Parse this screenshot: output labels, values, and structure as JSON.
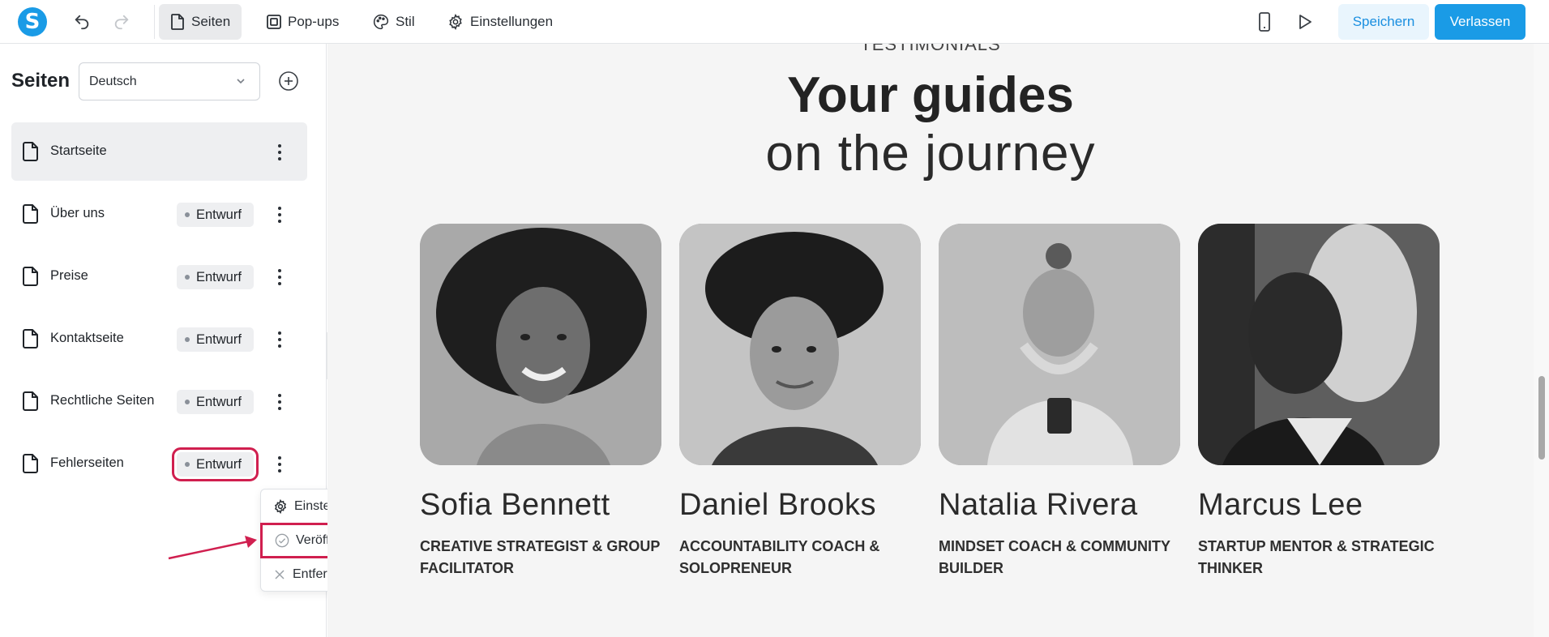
{
  "topbar": {
    "logo_letter": "S",
    "tabs": [
      {
        "label": "Seiten",
        "icon": "page-icon"
      },
      {
        "label": "Pop-ups",
        "icon": "popup-icon"
      },
      {
        "label": "Stil",
        "icon": "palette-icon"
      },
      {
        "label": "Einstellungen",
        "icon": "gear-icon"
      }
    ],
    "save_label": "Speichern",
    "exit_label": "Verlassen",
    "accent": "#1a9be6"
  },
  "sidebar": {
    "title": "Seiten",
    "language": "Deutsch",
    "pages": [
      {
        "name": "Startseite",
        "status": ""
      },
      {
        "name": "Über uns",
        "status": "Entwurf"
      },
      {
        "name": "Preise",
        "status": "Entwurf"
      },
      {
        "name": "Kontaktseite",
        "status": "Entwurf"
      },
      {
        "name": "Rechtliche Seiten",
        "status": "Entwurf"
      },
      {
        "name": "Fehlerseiten",
        "status": "Entwurf"
      }
    ],
    "menu": {
      "settings": "Einstellungen",
      "publish": "Veröffentlichen",
      "remove": "Entfernen"
    },
    "highlight_color": "#d01f4f"
  },
  "canvas": {
    "cut_text": "TESTIMONIALS",
    "headline_bold": "Your guides",
    "headline_light": "on the journey",
    "people": [
      {
        "name": "Sofia Bennett",
        "role": "CREATIVE STRATEGIST & GROUP FACILITATOR"
      },
      {
        "name": "Daniel Brooks",
        "role": "ACCOUNTABILITY COACH & SOLOPRENEUR"
      },
      {
        "name": "Natalia Rivera",
        "role": "MINDSET COACH & COMMUNITY BUILDER"
      },
      {
        "name": "Marcus Lee",
        "role": "STARTUP MENTOR & STRATEGIC THINKER"
      }
    ]
  }
}
